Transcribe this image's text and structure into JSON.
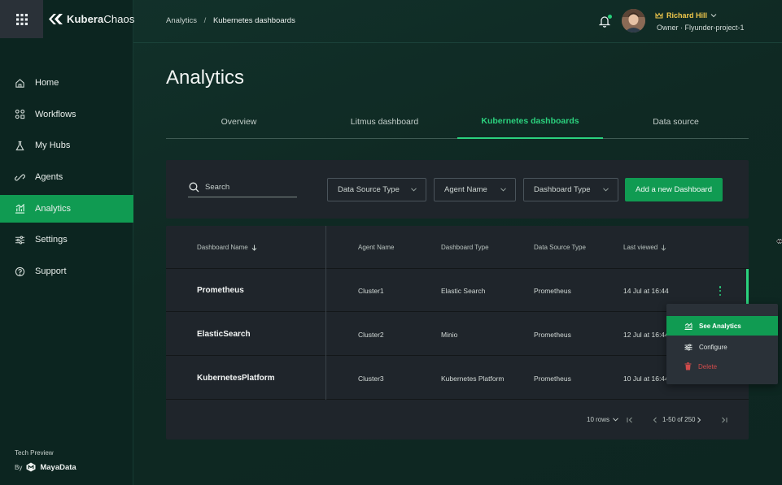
{
  "app": {
    "brand_name_bold": "Kubera",
    "brand_name_light": "Chaos"
  },
  "sidebar": {
    "items": [
      {
        "label": "Home",
        "icon": "home-icon"
      },
      {
        "label": "Workflows",
        "icon": "workflows-icon"
      },
      {
        "label": "My Hubs",
        "icon": "hubs-icon"
      },
      {
        "label": "Agents",
        "icon": "agents-icon"
      },
      {
        "label": "Analytics",
        "icon": "analytics-icon",
        "active": true
      },
      {
        "label": "Settings",
        "icon": "settings-icon"
      },
      {
        "label": "Support",
        "icon": "support-icon"
      }
    ],
    "tech_preview": "Tech Preview",
    "by_label": "By",
    "vendor": "MayaData"
  },
  "header": {
    "breadcrumb": {
      "root": "Analytics",
      "separator": "/",
      "current": "Kubernetes dashboards"
    },
    "user_name": "Richard Hill",
    "user_role": "Owner · Flyunder-project-1"
  },
  "page": {
    "title": "Analytics",
    "tabs": [
      {
        "label": "Overview"
      },
      {
        "label": "Litmus dashboard"
      },
      {
        "label": "Kubernetes dashboards",
        "active": true
      },
      {
        "label": "Data source"
      }
    ]
  },
  "filters": {
    "search_placeholder": "Search",
    "data_source_type": "Data Source Type",
    "agent_name": "Agent Name",
    "dashboard_type": "Dashboard Type",
    "add_button": "Add a new Dashboard"
  },
  "table": {
    "columns": {
      "name": "Dashboard Name",
      "agent": "Agent Name",
      "type": "Dashboard Type",
      "source": "Data Source Type",
      "viewed": "Last viewed"
    },
    "rows": [
      {
        "name": "Prometheus",
        "agent": "Cluster1",
        "type": "Elastic Search",
        "source": "Prometheus",
        "viewed": "14 Jul at 16:44"
      },
      {
        "name": "ElasticSearch",
        "agent": "Cluster2",
        "type": "Minio",
        "source": "Prometheus",
        "viewed": "12 Jul at 16:44"
      },
      {
        "name": "KubernetesPlatform",
        "agent": "Cluster3",
        "type": "Kubernetes Platform",
        "source": "Prometheus",
        "viewed": "10 Jul at 16:44"
      }
    ],
    "pagination": {
      "rows_per_page": "10 rows",
      "range": "1-50 of 250"
    }
  },
  "row_menu": {
    "see_analytics": "See Analytics",
    "configure": "Configure",
    "delete": "Delete"
  },
  "colors": {
    "accent": "#109b52",
    "accent_bright": "#2bd27e",
    "danger": "#d14b4b",
    "user_name": "#f2c94c"
  }
}
